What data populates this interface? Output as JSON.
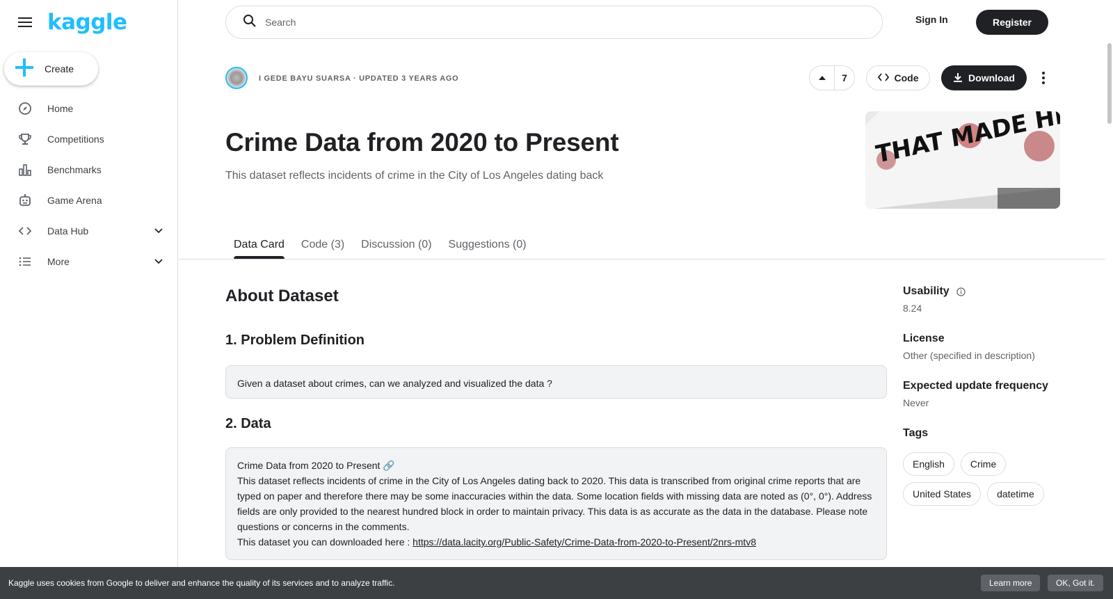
{
  "sidebar": {
    "logo": "kaggle",
    "create_label": "Create",
    "items": [
      {
        "label": "Home",
        "icon": "compass-icon"
      },
      {
        "label": "Competitions",
        "icon": "trophy-icon"
      },
      {
        "label": "Benchmarks",
        "icon": "bar-chart-icon"
      },
      {
        "label": "Game Arena",
        "icon": "robot-icon"
      },
      {
        "label": "Data Hub",
        "icon": "code-brackets-icon",
        "expandable": true
      },
      {
        "label": "More",
        "icon": "list-icon",
        "expandable": true
      }
    ]
  },
  "header": {
    "search_placeholder": "Search",
    "sign_in": "Sign In",
    "register": "Register"
  },
  "dataset": {
    "owner_line": "I GEDE BAYU SUARSA · UPDATED 3 YEARS AGO",
    "votes": "7",
    "code_label": "Code",
    "download_label": "Download",
    "title": "Crime Data from 2020 to Present",
    "subtitle": "This dataset reflects incidents of crime in the City of Los Angeles dating back",
    "thumbnail_alt": "THAT MADE HISTORY"
  },
  "tabs": [
    {
      "label": "Data Card",
      "active": true
    },
    {
      "label": "Code (3)",
      "active": false
    },
    {
      "label": "Discussion (0)",
      "active": false
    },
    {
      "label": "Suggestions (0)",
      "active": false
    }
  ],
  "content": {
    "about_heading": "About Dataset",
    "section1_heading": "1. Problem Definition",
    "section1_text": "Given a dataset about crimes, can we analyzed and visualized the data ?",
    "section2_heading": "2. Data",
    "section2_title_line": "Crime Data from 2020 to Present 🔗",
    "section2_body": "This dataset reflects incidents of crime in the City of Los Angeles dating back to 2020. This data is transcribed from original crime reports that are typed on paper and therefore there may be some inaccuracies within the data. Some location fields with missing data are noted as (0°, 0°). Address fields are only provided to the nearest hundred block in order to maintain privacy. This data is as accurate as the data in the database. Please note questions or concerns in the comments.",
    "section2_link_prefix": "This dataset you can downloaded here : ",
    "section2_link": "https://data.lacity.org/Public-Safety/Crime-Data-from-2020-to-Present/2nrs-mtv8"
  },
  "meta": {
    "usability_label": "Usability",
    "usability_value": "8.24",
    "license_label": "License",
    "license_value": "Other (specified in description)",
    "frequency_label": "Expected update frequency",
    "frequency_value": "Never",
    "tags_label": "Tags",
    "tags": [
      "English",
      "Crime",
      "United States",
      "datetime"
    ]
  },
  "cookie": {
    "message": "Kaggle uses cookies from Google to deliver and enhance the quality of its services and to analyze traffic.",
    "learn_more": "Learn more",
    "ok": "OK, Got it."
  },
  "colors": {
    "brand": "#20beff",
    "dark": "#202124",
    "muted": "#5f6368",
    "border": "#dadce0"
  }
}
